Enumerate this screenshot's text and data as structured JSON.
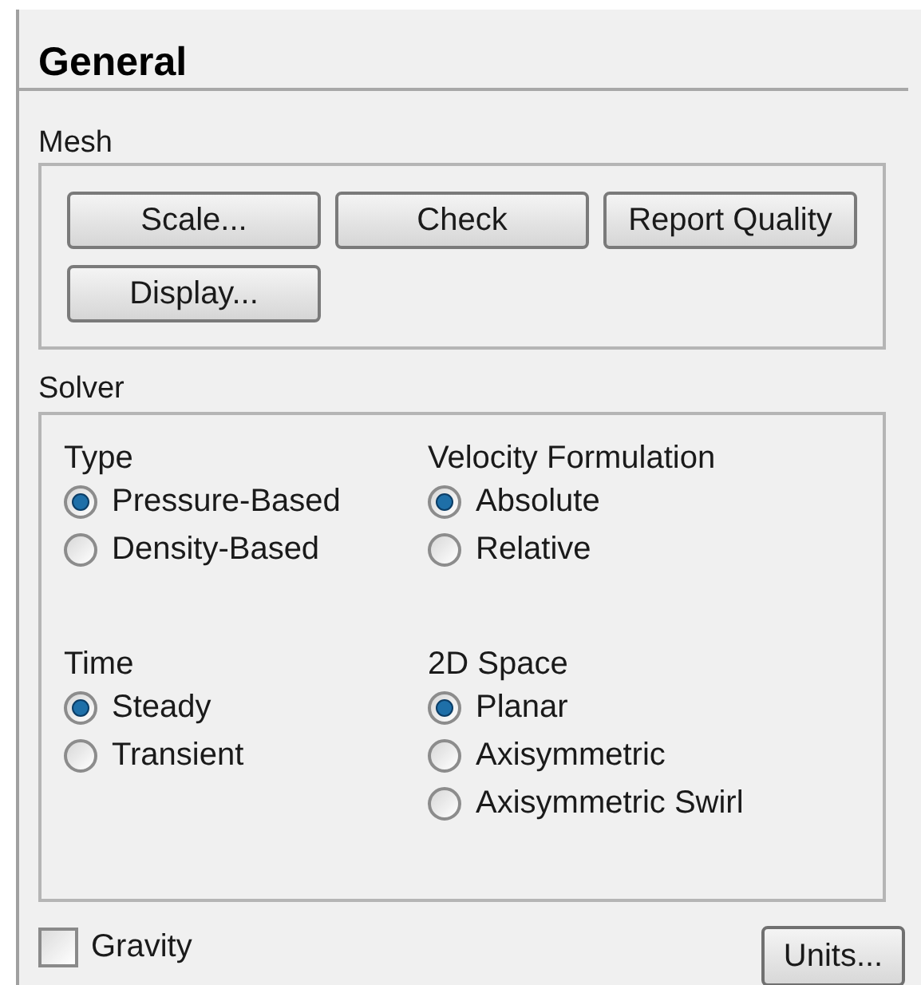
{
  "panel": {
    "title": "General"
  },
  "mesh": {
    "label": "Mesh",
    "buttons": [
      "Scale...",
      "Check",
      "Report Quality",
      "Display..."
    ]
  },
  "solver": {
    "label": "Solver",
    "groups": [
      {
        "title": "Type",
        "options": [
          {
            "label": "Pressure-Based",
            "selected": true
          },
          {
            "label": "Density-Based",
            "selected": false
          }
        ]
      },
      {
        "title": "Velocity Formulation",
        "options": [
          {
            "label": "Absolute",
            "selected": true
          },
          {
            "label": "Relative",
            "selected": false
          }
        ]
      },
      {
        "title": "Time",
        "options": [
          {
            "label": "Steady",
            "selected": true
          },
          {
            "label": "Transient",
            "selected": false
          }
        ]
      },
      {
        "title": "2D Space",
        "options": [
          {
            "label": "Planar",
            "selected": true
          },
          {
            "label": "Axisymmetric",
            "selected": false
          },
          {
            "label": "Axisymmetric Swirl",
            "selected": false
          }
        ]
      }
    ]
  },
  "gravity": {
    "label": "Gravity",
    "checked": false
  },
  "units_button": "Units..."
}
